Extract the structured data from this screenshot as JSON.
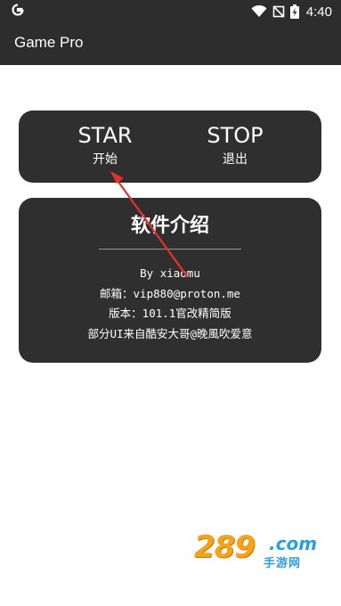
{
  "status_bar": {
    "time": "4:40",
    "icons": [
      "google-g-icon",
      "wifi-icon",
      "no-sim-icon",
      "battery-charging-icon"
    ]
  },
  "app_bar": {
    "title": "Game Pro"
  },
  "controls": {
    "start_label": "STAR",
    "start_sub": "开始",
    "stop_label": "STOP",
    "stop_sub": "退出"
  },
  "info": {
    "title": "软件介绍",
    "lines": [
      "By xiaomu",
      "邮箱：vip880@proton.me",
      "版本：101.1官改精简版",
      "部分UI来自酷安大哥@晚風吹爱意"
    ]
  },
  "annotation": {
    "type": "red-arrow",
    "color": "#e8302a"
  },
  "watermark": {
    "number": "289",
    "domain": ".com",
    "site_name": "手游网",
    "colors": {
      "primary": "#f7a21b",
      "secondary": "#2a9fe0"
    }
  },
  "colors": {
    "bar_background": "#2d2d2d",
    "card_background": "#2f2f2f",
    "page_background": "#ffffff",
    "text": "#ffffff"
  }
}
